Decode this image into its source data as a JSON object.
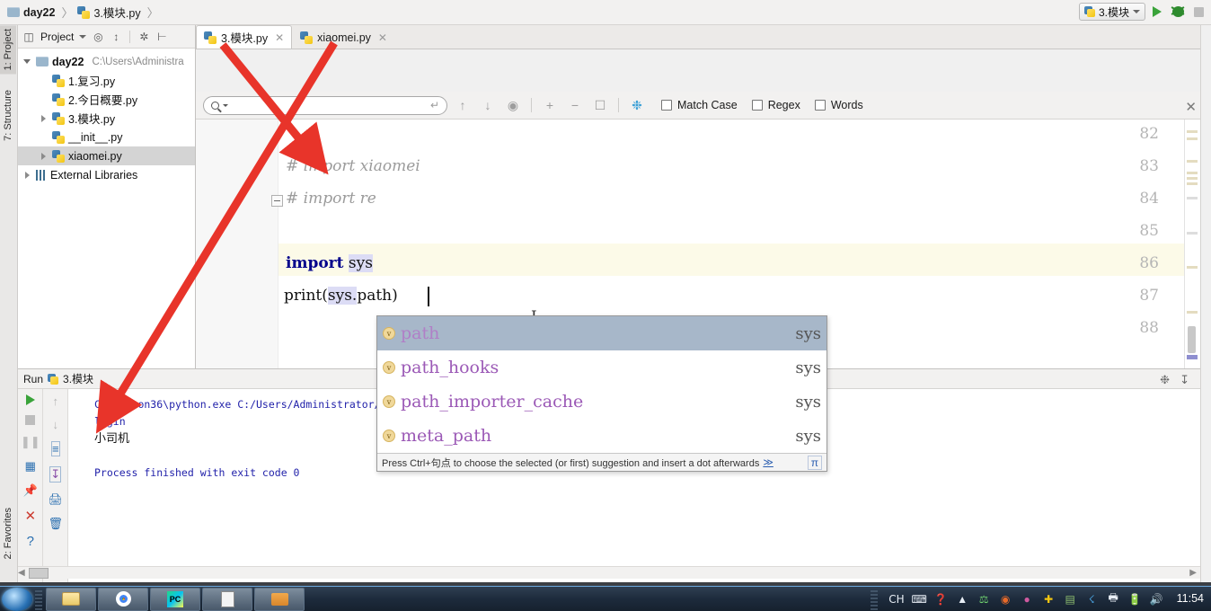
{
  "breadcrumb": {
    "project": "day22",
    "file": "3.模块.py",
    "separator": "〉"
  },
  "toolbar": {
    "run_config": "3.模块",
    "run_button": "run-icon",
    "debug_button": "debug-icon",
    "stop_button": "stop-icon"
  },
  "left_strip": {
    "project_tab": "1: Project",
    "structure_tab": "7: Structure",
    "favorites_tab": "2: Favorites"
  },
  "project_panel": {
    "title": "Project",
    "tree": [
      {
        "label": "day22",
        "path": "C:\\Users\\Administra",
        "bold": true,
        "indent": 0,
        "twisty": "down",
        "icon": "folder"
      },
      {
        "label": "1.复习.py",
        "path": "",
        "bold": false,
        "indent": 1,
        "twisty": "none",
        "icon": "python"
      },
      {
        "label": "2.今日概要.py",
        "path": "",
        "bold": false,
        "indent": 1,
        "twisty": "none",
        "icon": "python"
      },
      {
        "label": "3.模块.py",
        "path": "",
        "bold": false,
        "indent": 1,
        "twisty": "right",
        "icon": "python"
      },
      {
        "label": "__init__.py",
        "path": "",
        "bold": false,
        "indent": 1,
        "twisty": "none",
        "icon": "python"
      },
      {
        "label": "xiaomei.py",
        "path": "",
        "bold": false,
        "indent": 1,
        "twisty": "right",
        "icon": "python",
        "selected": true
      },
      {
        "label": "External Libraries",
        "path": "",
        "bold": false,
        "indent": 0,
        "twisty": "right",
        "icon": "libraries"
      }
    ]
  },
  "editor_tabs": [
    {
      "label": "3.模块.py",
      "active": true
    },
    {
      "label": "xiaomei.py",
      "active": false
    }
  ],
  "find_bar": {
    "query": "",
    "placeholder": "",
    "match_case": "Match Case",
    "regex": "Regex",
    "words": "Words",
    "close": "✕"
  },
  "editor": {
    "lines": [
      {
        "num": "82",
        "text": "",
        "kind": "blank"
      },
      {
        "num": "83",
        "text": "# import xiaomei",
        "kind": "comment"
      },
      {
        "num": "84",
        "text": "# import re",
        "kind": "comment",
        "fold": true
      },
      {
        "num": "85",
        "text": "",
        "kind": "blank"
      },
      {
        "num": "86",
        "text": "import sys",
        "kind": "import",
        "keyword": "import",
        "module": "sys"
      },
      {
        "num": "87",
        "text": "print(sys.path)",
        "kind": "current",
        "prefix": "print(",
        "highlight": "sys.",
        "typed": "path",
        "suffix": ")"
      },
      {
        "num": "88",
        "text": "",
        "kind": "blank"
      }
    ]
  },
  "autocomplete": {
    "items": [
      {
        "name": "path",
        "origin": "sys",
        "selected": true
      },
      {
        "name": "path_hooks",
        "origin": "sys",
        "selected": false
      },
      {
        "name": "path_importer_cache",
        "origin": "sys",
        "selected": false
      },
      {
        "name": "meta_path",
        "origin": "sys",
        "selected": false
      }
    ],
    "hint_prefix": "Press Ctrl+句点 to choose the selected (or first) suggestion and insert a dot afterwards",
    "hint_link": "≫",
    "badge": "v"
  },
  "run_panel": {
    "title": "Run",
    "config_name": "3.模块",
    "console": [
      {
        "text": "C:\\Python36\\python.exe C:/Users/Administrator/PycharmPr",
        "cjk": false
      },
      {
        "text": "login",
        "cjk": false
      },
      {
        "text": "小司机",
        "cjk": true
      },
      {
        "text": "",
        "cjk": false
      },
      {
        "text": "Process finished with exit code 0",
        "cjk": false
      }
    ]
  },
  "taskbar": {
    "ime": "CH",
    "clock": "11:54",
    "buttons": [
      "explorer",
      "chrome",
      "pycharm",
      "notepad",
      "folder"
    ]
  },
  "colors": {
    "accent": "#3a9fd6",
    "keyword": "#00008b",
    "comment": "#9b9b9b",
    "console_text": "#2222aa",
    "annotation": "#e8342a",
    "selection": "#a7b7c9",
    "current_line": "#fcfae8"
  }
}
